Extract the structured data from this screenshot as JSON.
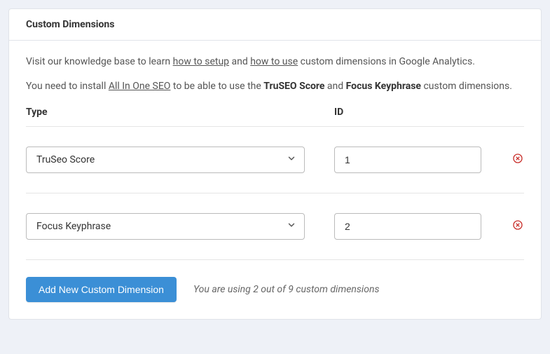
{
  "panel": {
    "title": "Custom Dimensions"
  },
  "intro": {
    "line1_prefix": "Visit our knowledge base to learn ",
    "link1": "how to setup",
    "line1_mid": " and ",
    "link2": "how to use",
    "line1_suffix": " custom dimensions in Google Analytics.",
    "line2_prefix": "You need to install ",
    "link3": "All In One SEO",
    "line2_mid1": " to be able to use the ",
    "strong1": "TruSEO Score",
    "line2_mid2": " and ",
    "strong2": "Focus Keyphrase",
    "line2_suffix": " custom dimensions."
  },
  "headers": {
    "type": "Type",
    "id": "ID"
  },
  "rows": [
    {
      "type": "TruSeo Score",
      "id": "1"
    },
    {
      "type": "Focus Keyphrase",
      "id": "2"
    }
  ],
  "footer": {
    "add_button": "Add New Custom Dimension",
    "usage": "You are using 2 out of 9 custom dimensions"
  }
}
